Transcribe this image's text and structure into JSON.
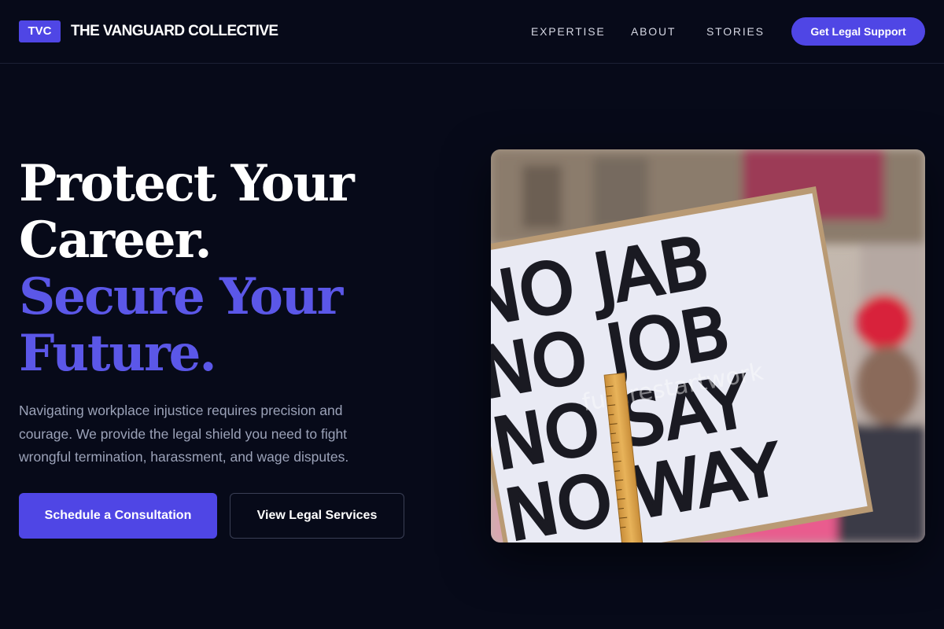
{
  "nav": {
    "badge": "TVC",
    "brand": "THE VANGUARD COLLECTIVE",
    "links": [
      "EXPERTISE",
      "ABOUT",
      "STORIES"
    ],
    "cta": "Get Legal Support"
  },
  "hero": {
    "headline": [
      "Protect Your",
      "Career."
    ],
    "headline_accent": [
      "Secure Your",
      "Future."
    ],
    "subtext": "Navigating workplace injustice requires precision and courage. We provide the legal shield you need to fight wrongful termination, harassment, and wage disputes.",
    "primary_button": "Schedule a Consultation",
    "secondary_button": "View Legal Services"
  },
  "image": {
    "sign_lines": [
      "NO JAB",
      "NO JOB",
      "NO SAY",
      "NO WAY"
    ],
    "watermark": "futurestartwork"
  },
  "colors": {
    "background": "#070a19",
    "accent": "#4f46e5",
    "accent_text": "#5b57e8",
    "muted_text": "#9ba2b8"
  }
}
